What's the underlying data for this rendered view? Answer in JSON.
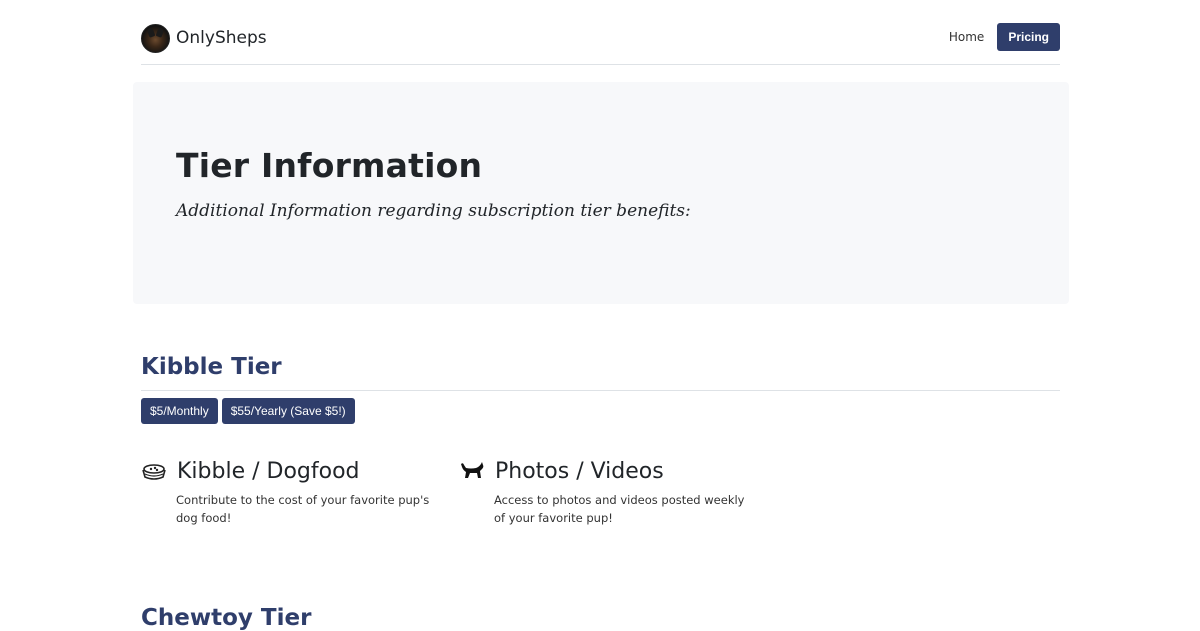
{
  "nav": {
    "brand": "OnlySheps",
    "home": "Home",
    "pricing": "Pricing"
  },
  "jumbotron": {
    "title": "Tier Information",
    "subtitle": "Additional Information regarding subscription tier benefits:"
  },
  "tiers": [
    {
      "name": "Kibble Tier",
      "prices": [
        "$5/Monthly",
        "$55/Yearly (Save $5!)"
      ],
      "features": [
        {
          "icon": "dog-bowl-icon",
          "title": "Kibble / Dogfood",
          "description": "Contribute to the cost of your favorite pup's dog food!"
        },
        {
          "icon": "dog-icon",
          "title": "Photos / Videos",
          "description": "Access to photos and videos posted weekly of your favorite pup!"
        }
      ]
    },
    {
      "name": "Chewtoy Tier"
    }
  ],
  "colors": {
    "accent": "#2f3e6b",
    "jumbotron_bg": "#f7f8fa",
    "divider": "#dee2e6"
  }
}
